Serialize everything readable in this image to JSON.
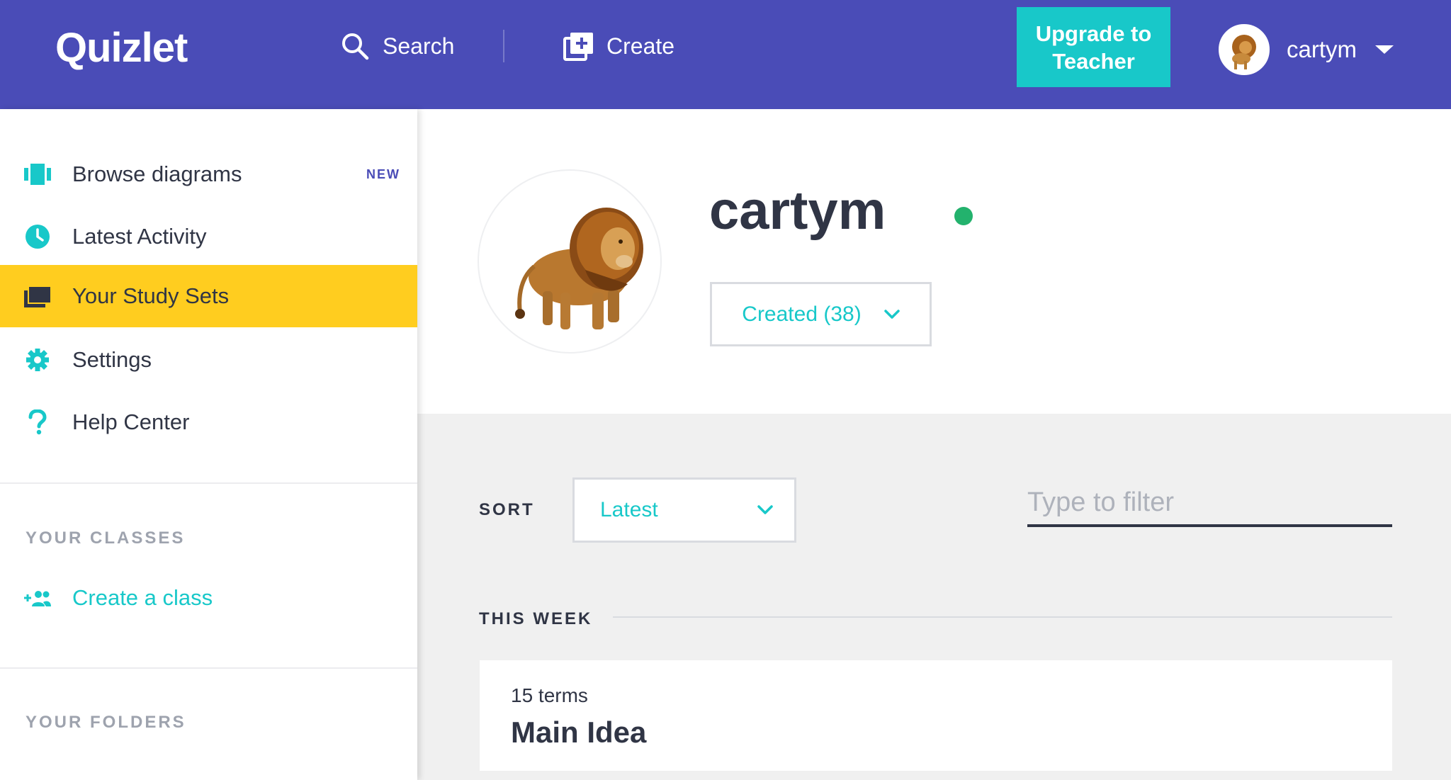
{
  "header": {
    "logo": "Quizlet",
    "search_label": "Search",
    "create_label": "Create",
    "upgrade_label": "Upgrade to Teacher",
    "username": "cartym"
  },
  "sidebar": {
    "items": [
      {
        "label": "Browse diagrams",
        "badge": "NEW",
        "icon": "diagram-icon"
      },
      {
        "label": "Latest Activity",
        "icon": "clock-icon"
      },
      {
        "label": "Your Study Sets",
        "icon": "study-sets-icon",
        "active": true
      },
      {
        "label": "Settings",
        "icon": "gear-icon"
      },
      {
        "label": "Help Center",
        "icon": "question-icon"
      }
    ],
    "classes_heading": "YOUR CLASSES",
    "create_class_label": "Create a class",
    "folders_heading": "YOUR FOLDERS"
  },
  "profile": {
    "name": "cartym",
    "filter_label": "Created (38)"
  },
  "list": {
    "sort_label": "SORT",
    "sort_value": "Latest",
    "filter_placeholder": "Type to filter",
    "section_label": "THIS WEEK",
    "sets": [
      {
        "terms": "15 terms",
        "title": "Main Idea"
      }
    ]
  },
  "colors": {
    "brand": "#4a4cb7",
    "accent": "#18c8c9",
    "active": "#ffcd1f",
    "online": "#23b26d"
  }
}
